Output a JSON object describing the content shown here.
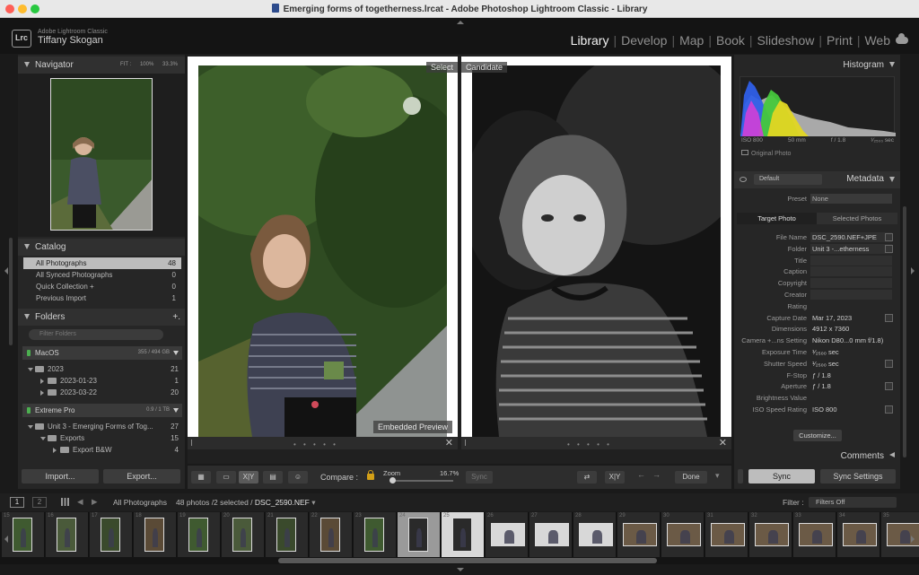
{
  "window": {
    "title": "Emerging forms of togetherness.lrcat - Adobe Photoshop Lightroom Classic - Library"
  },
  "identity": {
    "logo": "Lrc",
    "app": "Adobe Lightroom Classic",
    "user": "Tiffany Skogan"
  },
  "modules": {
    "items": [
      "Library",
      "Develop",
      "Map",
      "Book",
      "Slideshow",
      "Print",
      "Web"
    ],
    "active": "Library",
    "cloud_icon": "cloud-icon"
  },
  "navigator": {
    "title": "Navigator",
    "options": [
      "FIT :",
      "100%",
      "33.3%"
    ]
  },
  "catalog": {
    "title": "Catalog",
    "items": [
      {
        "label": "All Photographs",
        "count": "48",
        "selected": true
      },
      {
        "label": "All Synced Photographs",
        "count": "0"
      },
      {
        "label": "Quick Collection +",
        "count": "0"
      },
      {
        "label": "Previous Import",
        "count": "1"
      }
    ]
  },
  "folders": {
    "title": "Folders",
    "add": "+.",
    "filter_placeholder": "Filter Folders",
    "volumes": [
      {
        "name": "MacOS",
        "size": "355 / 494 GB",
        "rows": [
          {
            "label": "2023",
            "count": "21",
            "depth": 0,
            "open": true
          },
          {
            "label": "2023-01-23",
            "count": "1",
            "depth": 1
          },
          {
            "label": "2023-03-22",
            "count": "20",
            "depth": 1
          }
        ]
      },
      {
        "name": "Extreme Pro",
        "size": "0.9 / 1 TB",
        "rows": [
          {
            "label": "Unit 3 - Emerging Forms of Tog...",
            "count": "27",
            "depth": 0,
            "open": true
          },
          {
            "label": "Exports",
            "count": "15",
            "depth": 1,
            "open": true
          },
          {
            "label": "Export B&W",
            "count": "4",
            "depth": 2
          }
        ]
      }
    ]
  },
  "left_buttons": {
    "import": "Import...",
    "export": "Export..."
  },
  "compare": {
    "select_label": "Select",
    "candidate_label": "Candidate",
    "embedded_label": "Embedded Preview",
    "footer_dots": "• • • • •",
    "close": "✕"
  },
  "toolbar": {
    "compare_label": "Compare :",
    "zoom_label": "Zoom",
    "zoom_value": "16.7%",
    "sync": "Sync",
    "done": "Done",
    "xy": "X|Y"
  },
  "histogram": {
    "title": "Histogram",
    "iso": "ISO 800",
    "focal": "50 mm",
    "aperture": "f / 1.8",
    "shutter": "¹⁄₂₅₀₀ sec",
    "original_photo": "Original Photo",
    "colors": {
      "blue": "#2f5fe8",
      "green": "#46c83c",
      "yellow": "#e2d623",
      "magenta": "#d23fd6",
      "gray": "#b8b8b8"
    }
  },
  "metadata": {
    "title": "Metadata",
    "preset_select": "Default",
    "preset_label": "Preset",
    "preset_value": "None",
    "tab_target": "Target Photo",
    "tab_selected": "Selected Photos",
    "fields": [
      {
        "key": "File Name",
        "value": "DSC_2590.NEF+JPE",
        "field": true
      },
      {
        "key": "Folder",
        "value": "Unit 3 -...etherness",
        "field": true
      },
      {
        "key": "Title",
        "value": "",
        "field": true
      },
      {
        "key": "Caption",
        "value": "",
        "field": true
      },
      {
        "key": "Copyright",
        "value": "",
        "field": true
      },
      {
        "key": "Creator",
        "value": "",
        "field": true
      },
      {
        "key": "Rating",
        "value": "",
        "field": false
      },
      {
        "key": "Capture Date",
        "value": "Mar 17, 2023",
        "field": false
      },
      {
        "key": "Dimensions",
        "value": "4912 x 7360",
        "field": false
      },
      {
        "key": "Camera +...ns Setting",
        "value": "Nikon D80...0 mm f/1.8)",
        "field": false
      },
      {
        "key": "Exposure Time",
        "value": "¹⁄₂₅₀₀ sec",
        "field": false
      },
      {
        "key": "Shutter Speed",
        "value": "¹⁄₂₅₀₀ sec",
        "field": false
      },
      {
        "key": "F-Stop",
        "value": "ƒ / 1.8",
        "field": false
      },
      {
        "key": "Aperture",
        "value": "ƒ / 1.8",
        "field": false
      },
      {
        "key": "Brightness Value",
        "value": "",
        "field": false
      },
      {
        "key": "ISO Speed Rating",
        "value": "ISO 800",
        "field": false
      }
    ],
    "customize": "Customize..."
  },
  "comments": {
    "title": "Comments"
  },
  "right_buttons": {
    "sync": "Sync",
    "sync_settings": "Sync Settings"
  },
  "filmstrip_bar": {
    "page1": "1",
    "page2": "2",
    "source": "All Photographs",
    "info": "48 photos /2 selected /",
    "file": "DSC_2590.NEF",
    "filter_label": "Filter :",
    "filter_value": "Filters Off"
  },
  "filmstrip": {
    "numbers": [
      "15",
      "16",
      "17",
      "18",
      "19",
      "20",
      "21",
      "22",
      "23",
      "24",
      "25",
      "26",
      "27",
      "28",
      "29",
      "30",
      "31",
      "32",
      "33",
      "34",
      "35"
    ]
  }
}
